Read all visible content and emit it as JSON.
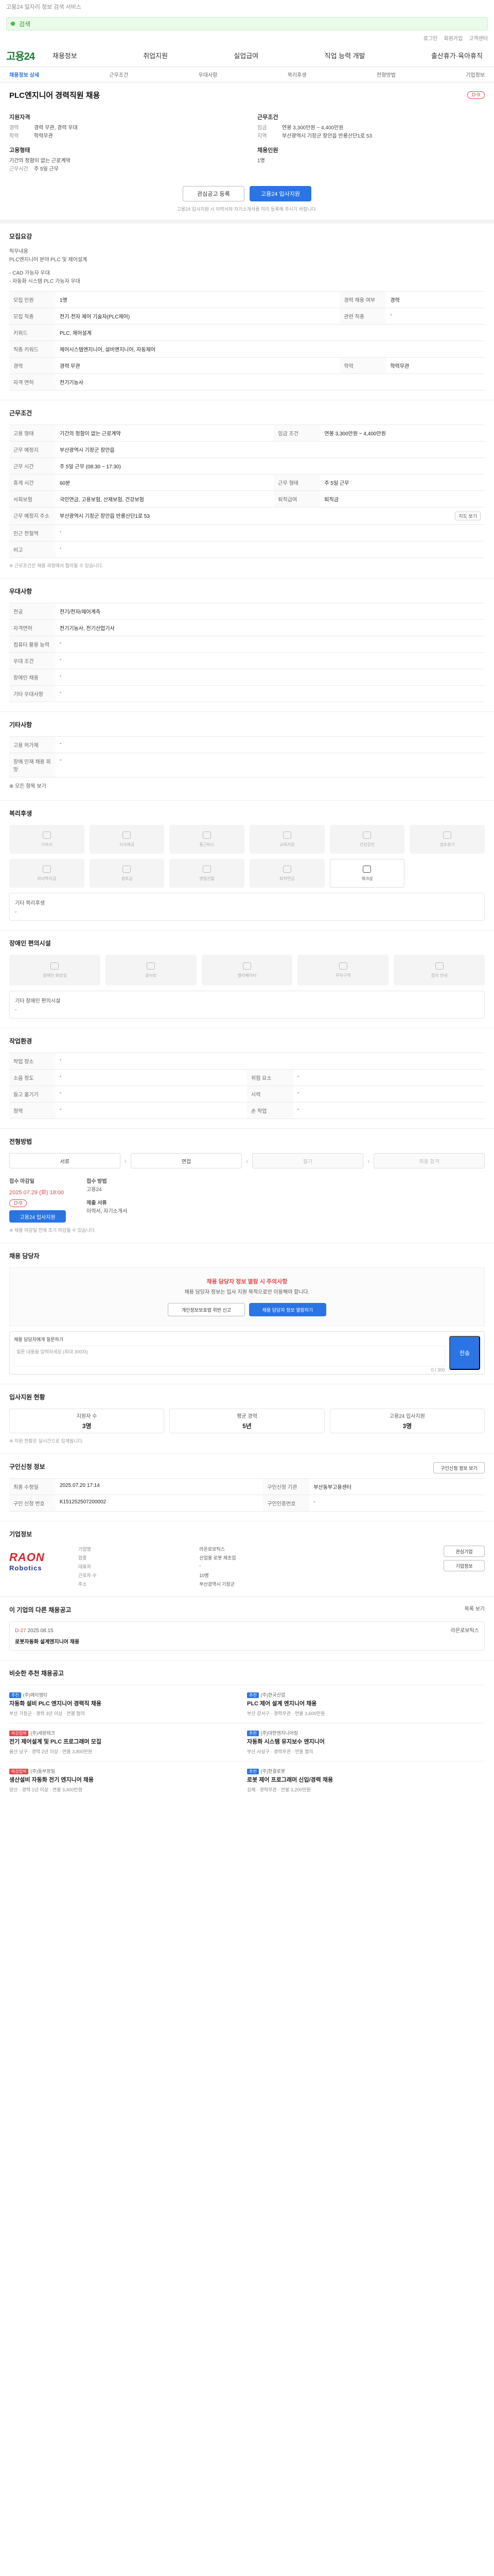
{
  "header": {
    "util_text": "고용24 일자리 정보 검색 서비스",
    "search_placeholder": "검색",
    "mini_links": [
      "로그인",
      "회원가입",
      "고객센터"
    ],
    "logo": "고용24",
    "gnb": [
      "채용정보",
      "취업지원",
      "실업급여",
      "직업 능력 개발",
      "출산휴가·육아휴직"
    ],
    "subtabs": [
      "채용정보 상세",
      "근무조건",
      "우대사항",
      "복리후생",
      "전형방법",
      "기업정보"
    ]
  },
  "job": {
    "title": "PLC엔지니어 경력직원 채용",
    "dday": "D-9",
    "left_heading": "지원자격",
    "right_heading": "근무조건",
    "career_k": "경력",
    "career_v": "경력 무관, 경력 우대",
    "edu_k": "학력",
    "edu_v": "학력무관",
    "pay_k": "임금",
    "pay_v": "연봉 3,300만원 ~ 4,400만원",
    "area_k": "지역",
    "area_v": "부산광역시 기장군 장안읍 반룡산단1로 53",
    "type_heading": "고용형태",
    "type_v": "기간의 정함이 없는 근로계약",
    "time_heading": "채용인원",
    "time_v": "1명",
    "work_k": "근무시간",
    "work_v": "주 5일 근무"
  },
  "buttons": {
    "save": "관심공고 등록",
    "apply": "고용24 입사지원"
  },
  "notice": "고용24 입사지원 시 이력서와 자기소개서를 미리 등록해 주시기 바랍니다.",
  "sections": {
    "detail": {
      "title": "모집요강",
      "lines": [
        "직무내용",
        "PLC엔지니어 분야 PLC 및 제어설계",
        "- CAD 가능자 우대",
        "- 자동화 시스템 PLC 가능자 우대"
      ]
    },
    "table1": [
      {
        "k": "모집 인원",
        "v": "1명",
        "k2": "경력 채용 여부",
        "v2": "경력"
      },
      {
        "k": "모집 직종",
        "v": "전기·전자 제어 기술자(PLC제어)",
        "k2": "관련 직종",
        "v2": "-"
      },
      {
        "k": "키워드",
        "v": "PLC, 제어설계",
        "k2": "",
        "v2": ""
      },
      {
        "k": "직종 키워드",
        "v": "제어시스템엔지니어, 설비엔지니어, 자동제어",
        "k2": "",
        "v2": ""
      },
      {
        "k": "경력",
        "v": "경력 무관",
        "k2": "학력",
        "v2": "학력무관"
      },
      {
        "k": "자격 면허",
        "v": "전기기능사",
        "k2": "",
        "v2": ""
      }
    ],
    "conditions": {
      "title": "근무조건",
      "rows": [
        {
          "k": "고용 형태",
          "v": "기간의 정함이 없는 근로계약",
          "k2": "임금 조건",
          "v2": "연봉 3,300만원 ~ 4,400만원"
        },
        {
          "k": "근무 예정지",
          "v": "부산광역시 기장군 장안읍",
          "k2": "",
          "v2": ""
        },
        {
          "k": "근무 시간",
          "v": "주 5일 근무 (08:30 ~ 17:30)",
          "k2": "",
          "v2": ""
        },
        {
          "k": "휴게 시간",
          "v": "60분",
          "k2": "근무 형태",
          "v2": "주 5일 근무"
        },
        {
          "k": "사회보험",
          "v": "국민연금, 고용보험, 산재보험, 건강보험",
          "k2": "퇴직급여",
          "v2": "퇴직금"
        },
        {
          "k": "근무 예정지 주소",
          "v": "부산광역시 기장군 장안읍 반룡산단1로 53",
          "k2": "",
          "v2": ""
        },
        {
          "k": "인근 전철역",
          "v": "-",
          "k2": "",
          "v2": ""
        },
        {
          "k": "비고",
          "v": "-",
          "k2": "",
          "v2": ""
        }
      ],
      "map_btn": "지도 보기",
      "note": "※ 근로조건은 채용 과정에서 협의될 수 있습니다."
    },
    "prefer": {
      "title": "우대사항",
      "rows": [
        {
          "k": "전공",
          "v": "전기/전자/제어계측"
        },
        {
          "k": "자격면허",
          "v": "전기기능사, 전기산업기사"
        },
        {
          "k": "컴퓨터 활용 능력",
          "v": "-"
        },
        {
          "k": "우대 조건",
          "v": "-"
        },
        {
          "k": "장애인 채용",
          "v": "-"
        },
        {
          "k": "기타 우대사항",
          "v": "-"
        }
      ]
    },
    "etc": {
      "title": "기타사항",
      "rows": [
        {
          "k": "고용 허가제",
          "v": "-"
        },
        {
          "k": "장애 인재 채용 희망",
          "v": "-"
        }
      ],
      "more": "모든 항목 보기"
    },
    "welfare": {
      "title": "복리후생",
      "items": [
        "기숙사",
        "식사제공",
        "통근버스",
        "교육지원",
        "건강검진",
        "경조휴가",
        "자녀학자금",
        "경조금",
        "명절선물",
        "퇴직연금",
        "워크샵",
        "차량유지비"
      ],
      "on": [
        11
      ],
      "extra_title": "기타 복리후생",
      "extra_v": "-"
    },
    "disabled": {
      "title": "장애인 편의시설",
      "items": [
        "장애인 화장실",
        "경사로",
        "엘리베이터",
        "주차구역",
        "점자 안내"
      ],
      "extra_title": "기타 장애인 편의시설",
      "extra_v": "-"
    },
    "env": {
      "title": "작업환경",
      "rows": [
        {
          "k": "작업 장소",
          "v": "-",
          "k2": "",
          "v2": ""
        },
        {
          "k": "소음 정도",
          "v": "-",
          "k2": "위험 요소",
          "v2": "-"
        },
        {
          "k": "들고 옮기기",
          "v": "-",
          "k2": "시력",
          "v2": "-"
        },
        {
          "k": "청력",
          "v": "-",
          "k2": "손 작업",
          "v2": "-"
        }
      ]
    },
    "process": {
      "title": "전형방법",
      "steps": [
        "서류",
        "면접",
        "필기",
        "최종 합격"
      ],
      "deadline_label": "접수 마감일",
      "deadline_v": "2025.07.29 (화) 18:00",
      "method_label": "접수 방법",
      "method_v": "고용24",
      "doc_label": "제출 서류",
      "doc_v": "이력서, 자기소개서",
      "apply_btn": "고용24 입사지원",
      "dday": "D-9",
      "note": "※ 채용 마감일 전에 조기 마감될 수 있습니다."
    },
    "contact": {
      "title": "채용 담당자",
      "box_title": "채용 담당자 정보 열람 시 주의사항",
      "box_text": "채용 담당자 정보는 입사 지원 목적으로만 이용해야 합니다.",
      "btn1": "개인정보보호법 위반 신고",
      "btn2": "채용 담당자 정보 열람하기",
      "qa_label": "채용 담당자에게 질문하기",
      "qa_placeholder": "질문 내용을 입력하세요 (최대 300자)",
      "qa_count": "0 / 300",
      "qa_btn": "전송"
    },
    "status": {
      "title": "입사지원 현황",
      "items": [
        {
          "k": "지원자 수",
          "v": "3명"
        },
        {
          "k": "평균 경력",
          "v": "5년"
        },
        {
          "k": "고용24 입사지원",
          "v": "3명"
        }
      ],
      "note": "※ 지원 현황은 실시간으로 집계됩니다."
    },
    "meta": {
      "title": "구인신청 정보",
      "btn": "구인신청 정보 보기",
      "rows": [
        {
          "k": "최종 수정일",
          "v": "2025.07.20 17:14",
          "k2": "구인신청 기관",
          "v2": "부산동부고용센터"
        },
        {
          "k": "구인 신청 번호",
          "v": "K151252507200002",
          "k2": "구인인증번호",
          "v2": "-"
        }
      ]
    },
    "company": {
      "title": "기업정보",
      "logo_main": "RAON",
      "logo_sub": "Robotics",
      "info": [
        "기업명",
        "라온로보틱스",
        "업종",
        "산업용 로봇 제조업",
        "대표자",
        "-",
        "근로자 수",
        "10명",
        "주소",
        "부산광역시 기장군"
      ],
      "btn1": "관심기업",
      "btn2": "기업정보"
    },
    "other": {
      "title": "이 기업의 다른 채용공고",
      "more": "목록 보기",
      "job_title": "로봇자동화 설계엔지니어 채용",
      "job_period": "2025.08.15",
      "job_company": "라온로보틱스",
      "dday": "D-27"
    },
    "recommend": {
      "title": "비슷한 추천 채용공고",
      "cards": [
        {
          "co": "(주)에이엠티",
          "tt": "자동화 설비 PLC 엔지니어 경력직 채용",
          "meta": "부산 기장군 · 경력 3년 이상 · 연봉 협의"
        },
        {
          "co": "(주)한국산업",
          "tt": "PLC 제어 설계 엔지니어 채용",
          "meta": "부산 강서구 · 경력무관 · 연봉 3,600만원"
        },
        {
          "co": "(주)세방테크",
          "tt": "전기 제어설계 및 PLC 프로그래머 모집",
          "meta": "울산 남구 · 경력 2년 이상 · 연봉 3,800만원"
        },
        {
          "co": "(주)대한엔지니어링",
          "tt": "자동화 시스템 유지보수 엔지니어",
          "meta": "부산 사상구 · 경력무관 · 연봉 협의"
        },
        {
          "co": "(주)동부정밀",
          "tt": "생산설비 자동화 전기 엔지니어 채용",
          "meta": "양산 · 경력 1년 이상 · 연봉 3,400만원"
        },
        {
          "co": "(주)한결로봇",
          "tt": "로봇 제어 프로그래머 신입/경력 채용",
          "meta": "김해 · 경력무관 · 연봉 3,200만원"
        }
      ],
      "tag1": "추천",
      "tag2": "마감임박"
    }
  }
}
